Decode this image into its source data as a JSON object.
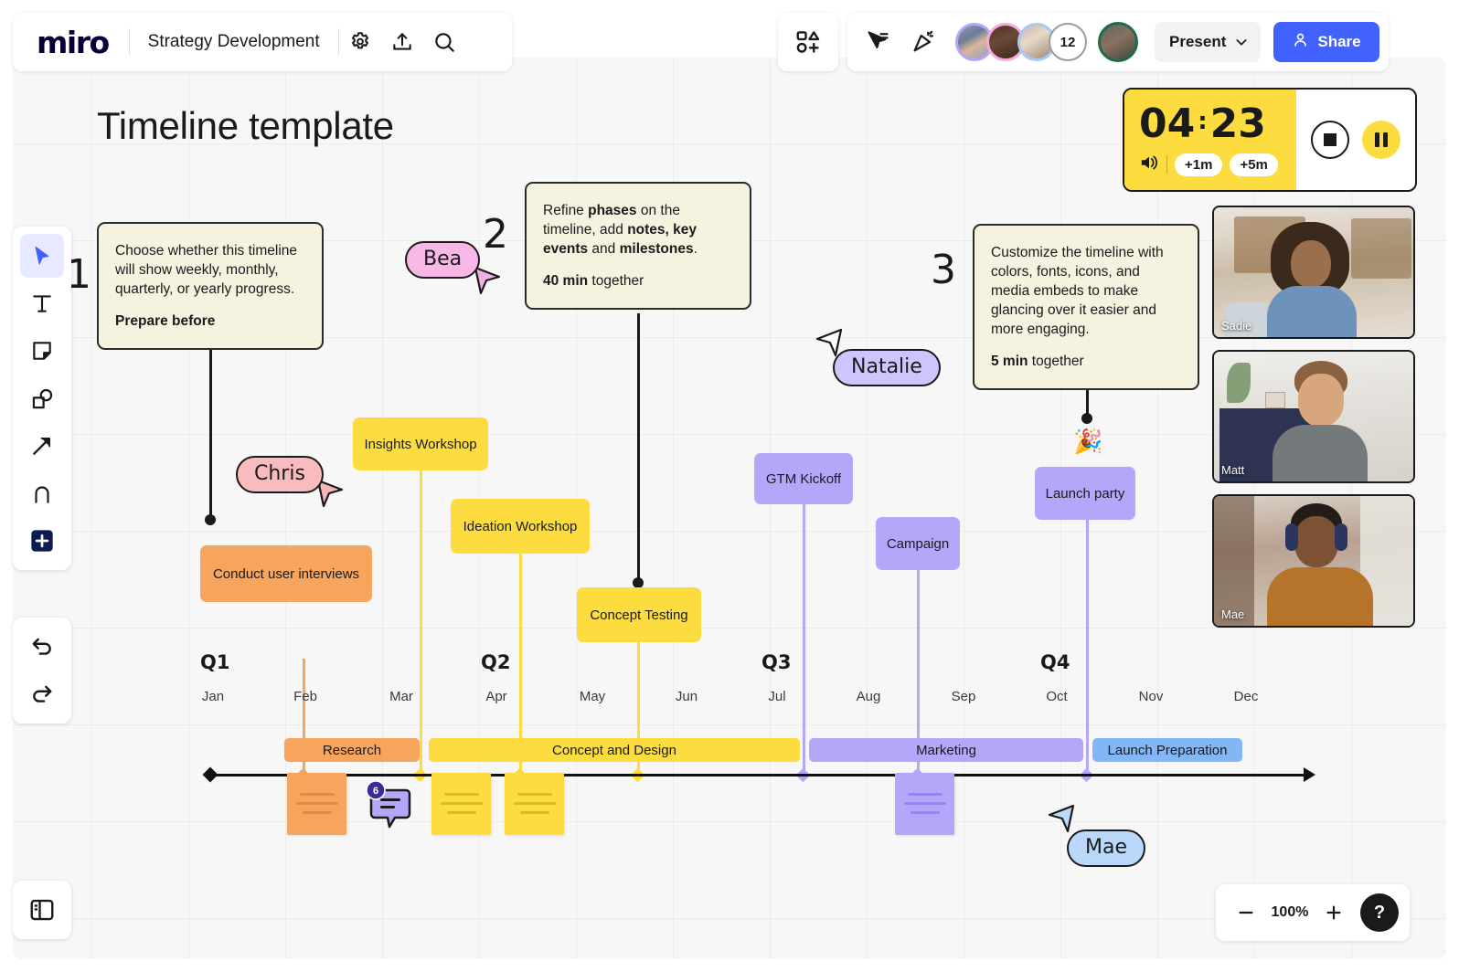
{
  "app": {
    "brand": "miro",
    "board_title": "Strategy Development",
    "header_icons": [
      "gear-icon",
      "upload-icon",
      "search-icon",
      "shapes-add-icon",
      "select-tools-icon",
      "reactions-icon"
    ],
    "present_label": "Present",
    "share_label": "Share",
    "collaborator_count": "12"
  },
  "timer": {
    "minutes": "04",
    "separator": ":",
    "seconds": "23",
    "add_1m": "+1m",
    "add_5m": "+5m",
    "sound_icon": "speaker-icon",
    "stop_label": "stop-button",
    "pause_label": "pause-button"
  },
  "toolbar": {
    "tools": [
      {
        "name": "select-tool",
        "icon": "cursor-icon"
      },
      {
        "name": "text-tool",
        "icon": "text-t-icon"
      },
      {
        "name": "sticky-note-tool",
        "icon": "sticky-note-icon"
      },
      {
        "name": "shapes-tool",
        "icon": "shapes-icon"
      },
      {
        "name": "connector-tool",
        "icon": "arrow-icon"
      },
      {
        "name": "pen-tool",
        "icon": "pen-icon"
      },
      {
        "name": "more-apps-tool",
        "icon": "plus-square-icon"
      }
    ],
    "history": [
      {
        "name": "undo-button",
        "icon": "undo-icon"
      },
      {
        "name": "redo-button",
        "icon": "redo-icon"
      }
    ],
    "panel_toggle": "open-panel-icon"
  },
  "board": {
    "heading": "Timeline template",
    "steps": [
      "1",
      "2",
      "3"
    ],
    "instructions": [
      {
        "number": "1",
        "body": "Choose whether this timeline will show weekly, monthly, quarterly, or yearly progress.",
        "footer_bold": "Prepare before",
        "footer_rest": ""
      },
      {
        "number": "2",
        "body_parts": [
          "Refine ",
          "phases",
          " on the timeline, add ",
          "notes, key events",
          " and ",
          "milestones",
          "."
        ],
        "footer_bold": "40 min",
        "footer_rest": " together"
      },
      {
        "number": "3",
        "body": "Customize the timeline with colors, fonts, icons, and media embeds to make glancing over it easier and more engaging.",
        "footer_bold": "5 min",
        "footer_rest": " together"
      }
    ]
  },
  "chart_data": {
    "type": "timeline",
    "title": "Timeline template",
    "axis": {
      "quarters": [
        "Q1",
        "Q2",
        "Q3",
        "Q4"
      ],
      "months": [
        "Jan",
        "Feb",
        "Mar",
        "Apr",
        "May",
        "Jun",
        "Jul",
        "Aug",
        "Sep",
        "Oct",
        "Nov",
        "Dec"
      ]
    },
    "milestones": [
      {
        "label": "Conduct user interviews",
        "month": "Feb",
        "color": "#f7a55c"
      },
      {
        "label": "Insights Workshop",
        "month": "Mar",
        "color": "#fddc3f"
      },
      {
        "label": "Ideation Workshop",
        "month": "Apr",
        "color": "#fddc3f"
      },
      {
        "label": "Concept Testing",
        "month": "May",
        "color": "#fddc3f"
      },
      {
        "label": "GTM Kickoff",
        "month": "Jul",
        "color": "#b3a7fa"
      },
      {
        "label": "Campaign",
        "month": "Sep",
        "color": "#b3a7fa"
      },
      {
        "label": "Launch party",
        "month": "Oct",
        "color": "#b3a7fa"
      }
    ],
    "phases": [
      {
        "label": "Research",
        "color": "#f7a55c",
        "start": "Feb",
        "end": "Mar"
      },
      {
        "label": "Concept and Design",
        "color": "#fddc3f",
        "start": "Mar",
        "end": "Jul"
      },
      {
        "label": "Marketing",
        "color": "#b3a7fa",
        "start": "Jul",
        "end": "Oct"
      },
      {
        "label": "Launch Preparation",
        "color": "#82b6f7",
        "start": "Oct",
        "end": "Dec"
      }
    ],
    "sticky_notes": [
      {
        "color": "#f7a55c",
        "lines": 3
      },
      {
        "color": "#fddc3f",
        "lines": 3
      },
      {
        "color": "#fddc3f",
        "lines": 3
      },
      {
        "color": "#b3a7fa",
        "lines": 3
      }
    ],
    "comment": {
      "count": "6",
      "icon": "comment-icon"
    }
  },
  "cursors": [
    {
      "name": "Bea",
      "fill": "#f7b8e8",
      "arrow": "#efb0e4"
    },
    {
      "name": "Chris",
      "fill": "#f9bcbe",
      "arrow": "#f7b4b6"
    },
    {
      "name": "Natalie",
      "fill": "#cfc4fb",
      "arrow": "#ffffff"
    },
    {
      "name": "Mae",
      "fill": "#b9d8fa",
      "arrow": "#bcdaf9"
    }
  ],
  "video_panel": [
    {
      "name": "Sadie"
    },
    {
      "name": "Matt"
    },
    {
      "name": "Mae"
    }
  ],
  "zoom_controls": {
    "minus": "minus-icon",
    "level": "100%",
    "plus": "plus-icon",
    "help": "?"
  },
  "colors": {
    "accent_blue": "#4262ff",
    "timer_yellow": "#fddc3f",
    "orange": "#f7a55c",
    "yellow": "#fddc3f",
    "purple": "#b3a7fa",
    "blue": "#82b6f7",
    "note_bg": "#f5f2e0"
  }
}
